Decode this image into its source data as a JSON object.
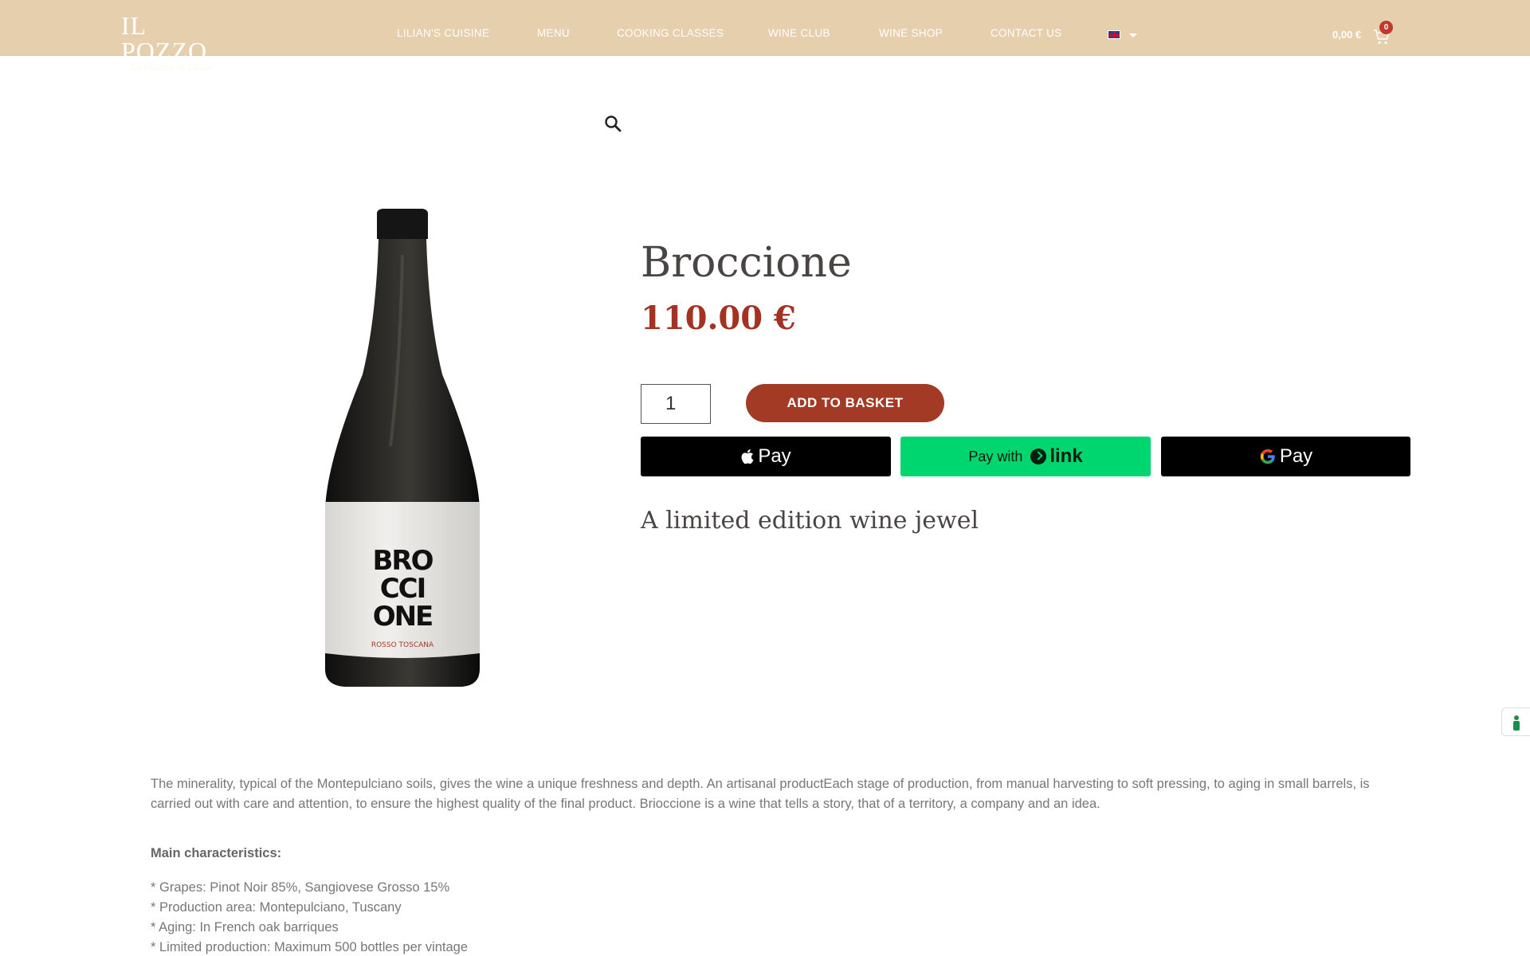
{
  "header": {
    "logo_text": "IL POZZO",
    "logo_subtitle": "La cucina di Lilian",
    "nav": [
      {
        "label": "LILIAN'S CUISINE"
      },
      {
        "label": "MENU"
      },
      {
        "label": "COOKING CLASSES"
      },
      {
        "label": "WINE CLUB"
      },
      {
        "label": "WINE SHOP"
      },
      {
        "label": "CONTACT US"
      }
    ],
    "language": "EN",
    "cart_total": "0,00 €",
    "cart_count": "0"
  },
  "product": {
    "title": "Broccione",
    "price": "110.00 €",
    "quantity": "1",
    "add_to_basket_label": "ADD TO BASKET",
    "apple_pay_label": "Pay",
    "link_pay_prefix": "Pay with",
    "link_pay_brand": "link",
    "google_pay_label": "Pay",
    "tagline": "A limited edition wine jewel",
    "bottle_label_text": "BROCCIONE",
    "bottle_sub_label": "ROSSO TOSCANA"
  },
  "description": {
    "paragraph": "The minerality, typical of the Montepulciano soils, gives the wine a unique freshness and depth. An artisanal productEach stage of production, from manual harvesting to soft pressing, to aging in small barrels, is carried out with care and attention, to ensure the highest quality of the final product. Brioccione is a wine that tells a story, that of a territory, a company and an idea.",
    "heading": "Main characteristics:",
    "characteristics": [
      "* Grapes: Pinot Noir 85%, Sangiovese Grosso 15%",
      "* Production area: Montepulciano, Tuscany",
      "* Aging: In French oak barriques",
      "* Limited production: Maximum 500 bottles per vintage"
    ]
  },
  "colors": {
    "header_bg": "#e6cfac",
    "accent": "#a33a26",
    "link_green": "#00d66f"
  }
}
